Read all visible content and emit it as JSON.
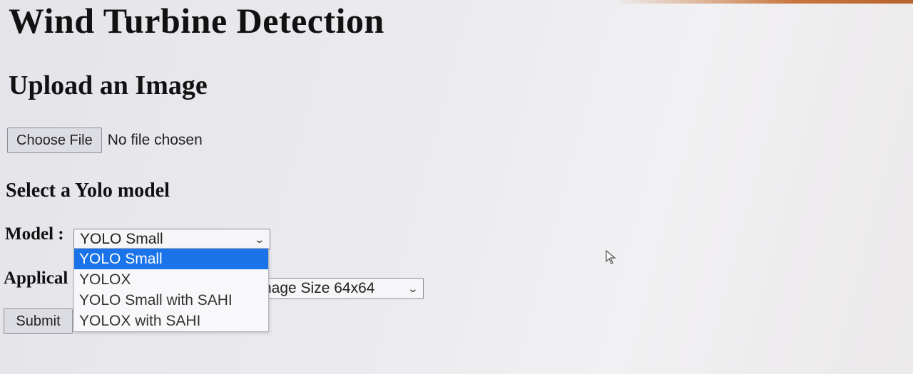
{
  "page": {
    "title": "Wind Turbine Detection",
    "upload_heading": "Upload an Image",
    "file_button_label": "Choose File",
    "file_status": "No file chosen",
    "model_section_heading": "Select a Yolo model",
    "model_label": "Model :",
    "model_selected": "YOLO Small",
    "model_options": [
      "YOLO Small",
      "YOLOX",
      "YOLO Small with SAHI",
      "YOLOX with SAHI"
    ],
    "application_label_visible": "Applical",
    "application_selected_visible": "nage Size 64x64",
    "submit_label": "Submit"
  },
  "icons": {
    "select_arrow": "chevron-down-icon",
    "mouse_cursor": "mouse-pointer-icon"
  },
  "colors": {
    "highlight": "#1a73e8",
    "accent_top_edge": "#c9773f"
  }
}
